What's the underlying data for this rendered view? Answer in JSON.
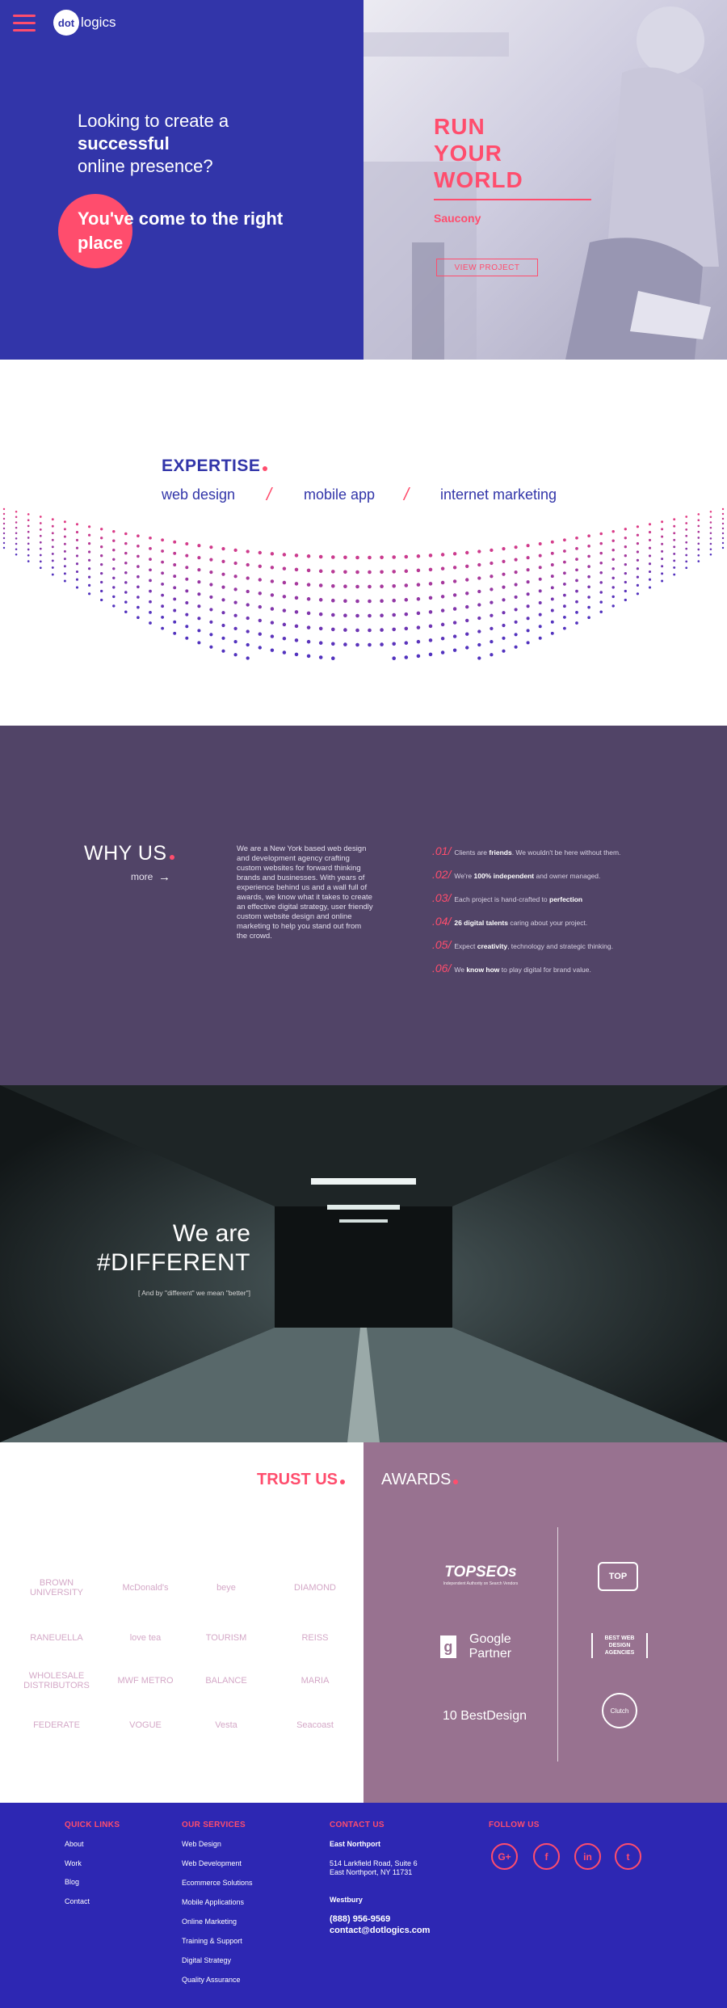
{
  "colors": {
    "accent": "#ff4d6d",
    "brand_blue": "#3235a9",
    "why_bg": "#514467",
    "awards_bg": "#987290",
    "footer_bg": "#2d27b3"
  },
  "header": {
    "logo_mark": "dot",
    "logo_text": "logics",
    "menu_icon": "hamburger-icon"
  },
  "hero": {
    "question_line1": "Looking to create a",
    "question_line2": "successful",
    "question_line3": "online presence?",
    "cta_line1": "You've come to the right",
    "cta_line2": "place",
    "feature_line1": "RUN",
    "feature_line2": "YOUR",
    "feature_line3": "WORLD",
    "feature_client": "Saucony",
    "view_project": "VIEW PROJECT"
  },
  "expertise": {
    "title": "EXPERTISE",
    "items": [
      "web design",
      "mobile app",
      "internet marketing"
    ],
    "separator": "/"
  },
  "why": {
    "title": "WHY US",
    "more": "more",
    "body": "We are a New York based web design and development agency crafting custom websites for forward thinking brands and businesses. With years of experience behind us and a wall full of awards, we know what it takes to create an effective digital strategy, user friendly custom website design and online marketing to help you stand out from the crowd.",
    "points": [
      {
        "num": ".01/",
        "pre": "Clients are ",
        "bold": "friends",
        "post": ". We wouldn't be here without them."
      },
      {
        "num": ".02/",
        "pre": "We're ",
        "bold": "100% independent",
        "post": " and owner managed."
      },
      {
        "num": ".03/",
        "pre": "Each project is hand-crafted to ",
        "bold": "perfection",
        "post": ""
      },
      {
        "num": ".04/",
        "pre": "",
        "bold": "26 digital talents",
        "post": " caring about your project."
      },
      {
        "num": ".05/",
        "pre": "Expect ",
        "bold": "creativity",
        "post": ", technology and strategic thinking."
      },
      {
        "num": ".06/",
        "pre": "We ",
        "bold": "know how",
        "post": " to play digital for brand value."
      }
    ]
  },
  "different": {
    "line1": "We are",
    "line2": "#DIFFERENT",
    "sub": "[ And by \"different\" we mean \"better\"]"
  },
  "trust": {
    "title": "TRUST US",
    "brands": [
      "BROWN UNIVERSITY",
      "McDonald's",
      "beye",
      "DIAMOND",
      "RANEUELLA",
      "love tea",
      "TOURISM",
      "REISS",
      "WHOLESALE DISTRIBUTORS",
      "MWF METRO",
      "BALANCE",
      "MARIA",
      "FEDERATE",
      "VOGUE",
      "Vesta",
      "Seacoast"
    ]
  },
  "awards": {
    "title": "AWARDS",
    "items": [
      "TOPSEOs",
      "Google Partner",
      "10 BestDesign",
      "TOP",
      "BEST WEB DESIGN AGENCIES",
      "Clutch"
    ],
    "topseos_sub": "Independent Authority on Search Vendors"
  },
  "footer": {
    "quick_links": {
      "title": "QUICK LINKS",
      "items": [
        "About",
        "Work",
        "Blog",
        "Contact"
      ]
    },
    "services": {
      "title": "OUR SERVICES",
      "items": [
        "Web Design",
        "Web Development",
        "Ecommerce Solutions",
        "Mobile Applications",
        "Online Marketing",
        "Training & Support",
        "Digital Strategy",
        "Quality Assurance"
      ]
    },
    "contact": {
      "title": "CONTACT US",
      "office1": "East Northport",
      "address1": "514 Larkfield Road, Suite 6",
      "address2": "East Northport, NY 11731",
      "office2": "Westbury",
      "phone": "(888) 956-9569",
      "email": "contact@dotlogics.com"
    },
    "follow": {
      "title": "FOLLOW US",
      "icons": [
        "google-plus-icon",
        "flickr-icon",
        "linkedin-icon",
        "twitter-icon"
      ],
      "labels": [
        "G+",
        "f",
        "in",
        "t"
      ]
    }
  }
}
